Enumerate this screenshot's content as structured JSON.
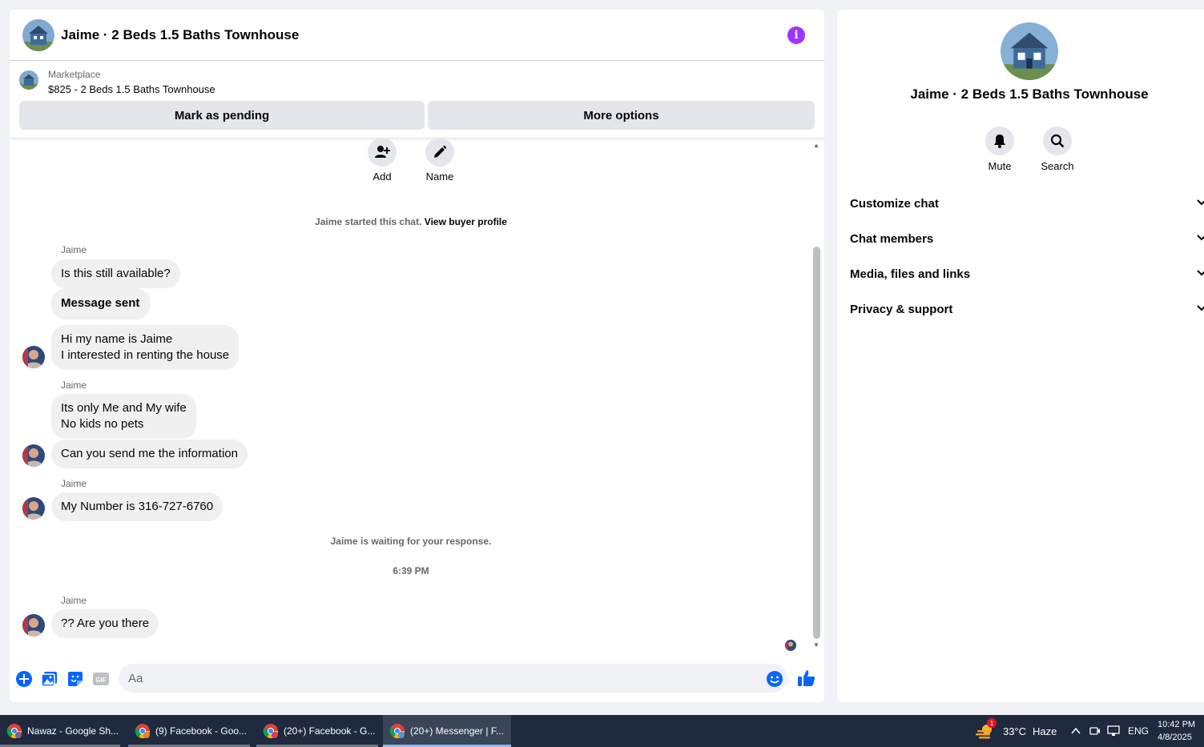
{
  "chat": {
    "title": "Jaime · 2 Beds 1.5 Baths Townhouse",
    "marketplace": {
      "label": "Marketplace",
      "listing": "$825 - 2 Beds 1.5 Baths Townhouse",
      "pending_button": "Mark as pending",
      "more_button": "More options"
    },
    "quick_actions": {
      "add": "Add",
      "name": "Name"
    },
    "started_text": "Jaime started this chat.",
    "view_profile": "View buyer profile",
    "sender": "Jaime",
    "messages": [
      "Is this still available?",
      "Message sent",
      "Hi my name is Jaime\nI interested in renting the house",
      "Its only Me and My wife\nNo kids no pets",
      "Can you send me the information",
      "My Number is 316-727-6760",
      "?? Are you there"
    ],
    "waiting_text": "Jaime is waiting for your response.",
    "timestamp": "6:39 PM",
    "composer_placeholder": "Aa"
  },
  "details": {
    "title": "Jaime · 2 Beds 1.5 Baths Townhouse",
    "mute": "Mute",
    "search": "Search",
    "sections": [
      "Customize chat",
      "Chat members",
      "Media, files and links",
      "Privacy & support"
    ]
  },
  "taskbar": {
    "items": [
      "Nawaz - Google Sh...",
      "(9) Facebook - Goo...",
      "(20+) Facebook - G...",
      "(20+) Messenger | F..."
    ],
    "weather_badge": "1",
    "weather": "33°C",
    "weather_desc": "Haze",
    "lang": "ENG",
    "time": "10:42 PM",
    "date": "4/8/2025"
  },
  "colors": {
    "accent": "#0866ff",
    "info": "#a033ff",
    "bubble": "#f0f0f0",
    "taskbar": "#1f2a3e"
  }
}
